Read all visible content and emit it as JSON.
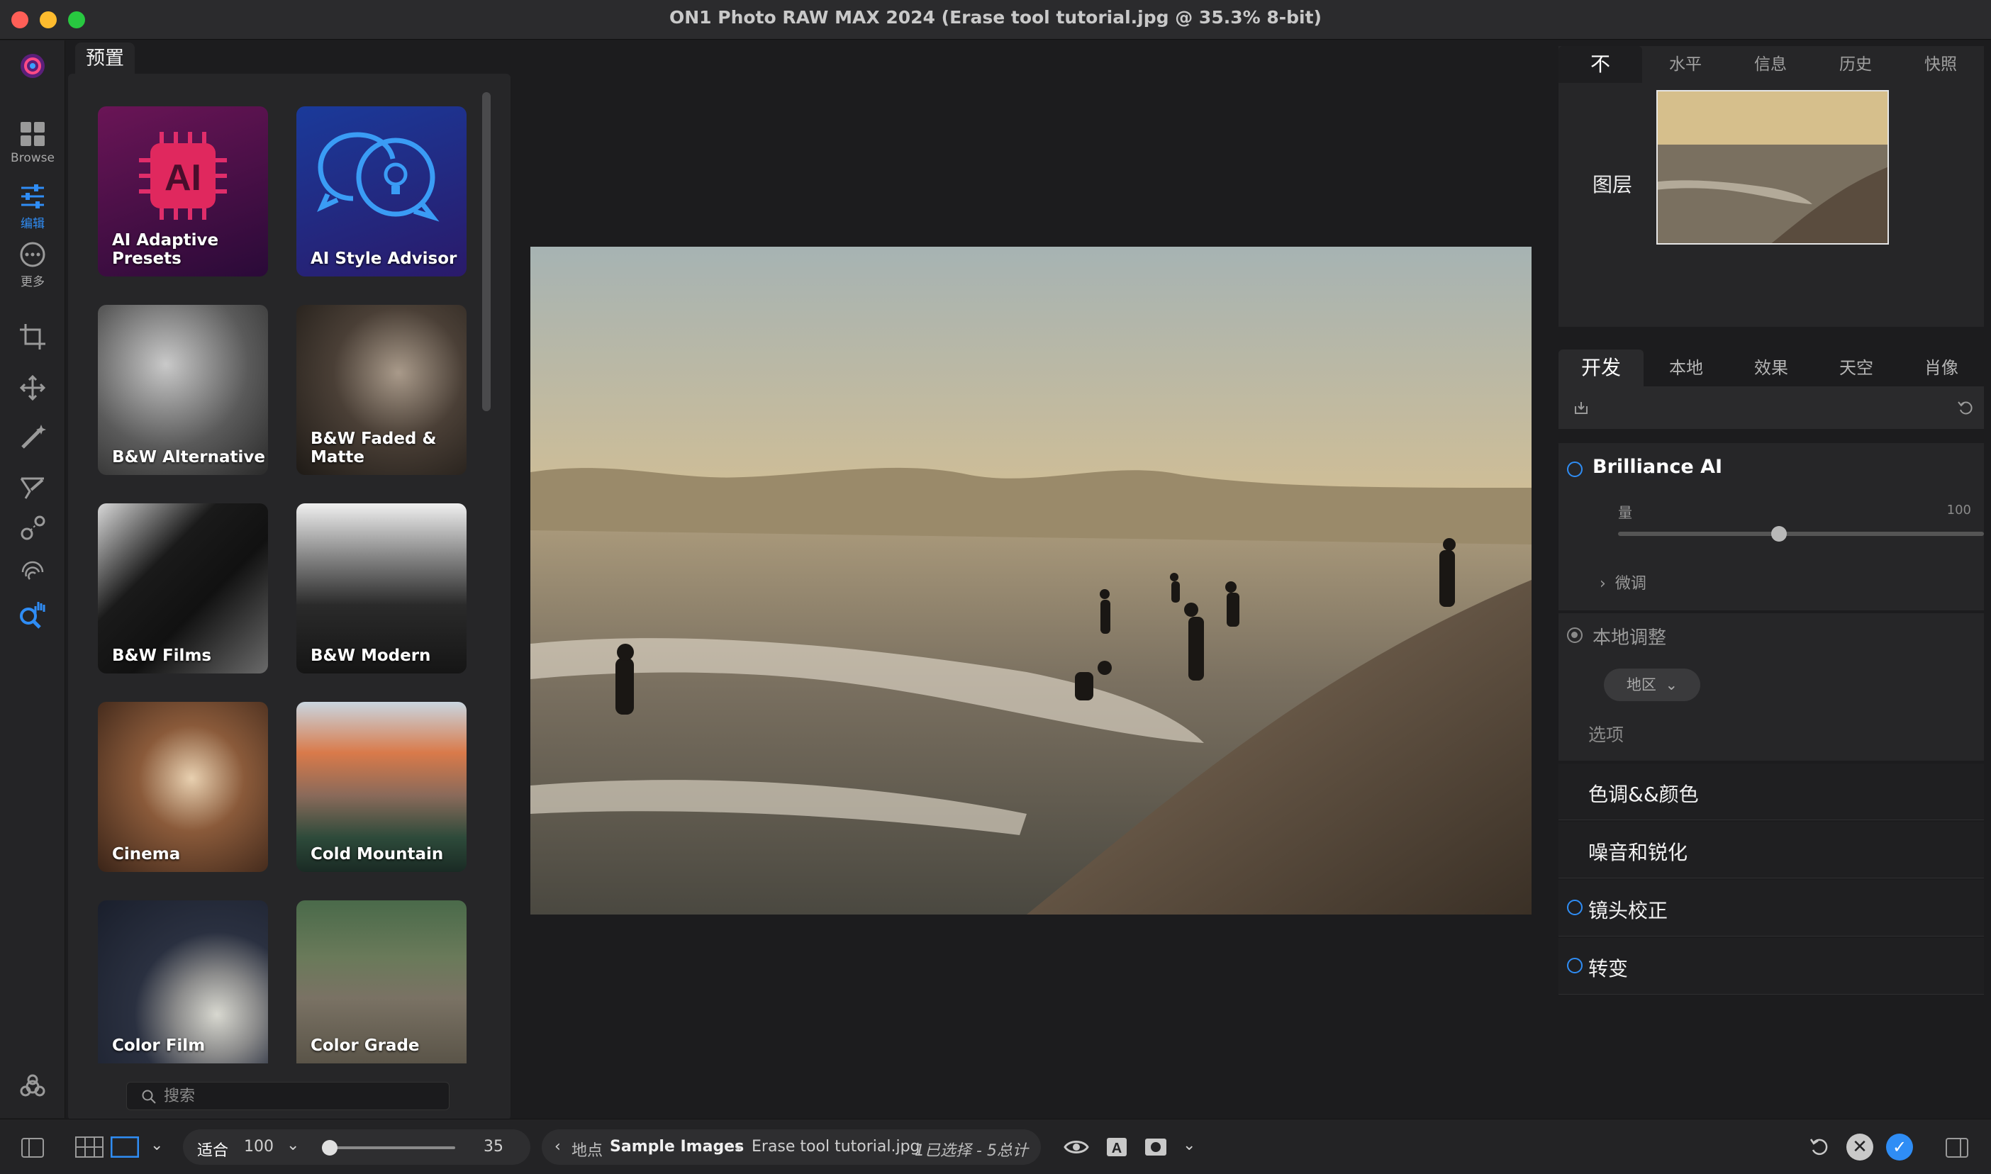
{
  "window": {
    "title": "ON1 Photo RAW MAX 2024 (Erase tool tutorial.jpg @ 35.3% 8-bit)"
  },
  "left_toolbar": {
    "browse_label": "Browse",
    "edit_label": "编辑",
    "more_label": "更多"
  },
  "presets": {
    "tab_label": "预置",
    "search_placeholder": "搜索",
    "items": [
      {
        "label": "AI Adaptive Presets"
      },
      {
        "label": "AI Style Advisor"
      },
      {
        "label": "B&W Alternative"
      },
      {
        "label": "B&W Faded & Matte"
      },
      {
        "label": "B&W Films"
      },
      {
        "label": "B&W Modern"
      },
      {
        "label": "Cinema"
      },
      {
        "label": "Cold Mountain"
      },
      {
        "label": "Color Film"
      },
      {
        "label": "Color Grade"
      }
    ]
  },
  "right_panel": {
    "top_tabs": [
      "不",
      "水平",
      "信息",
      "历史",
      "快照"
    ],
    "layers_title": "图层",
    "sub_tabs": [
      "开发",
      "本地",
      "效果",
      "天空",
      "肖像"
    ],
    "brilliance": {
      "title": "Brilliance AI",
      "amount_label": "量",
      "amount_value": "100",
      "amount_fraction": 0.44,
      "fine_tune_label": "微调"
    },
    "local_adjust": {
      "title": "本地调整",
      "region_label": "地区",
      "options_label": "选项"
    },
    "sections": [
      {
        "label": "色调&&颜色",
        "has_radio": false
      },
      {
        "label": "噪音和锐化",
        "has_radio": false
      },
      {
        "label": "镜头校正",
        "has_radio": true
      },
      {
        "label": "转变",
        "has_radio": true
      }
    ]
  },
  "bottom_bar": {
    "fit_label": "适合",
    "zoom_value": "100",
    "size_value": "35",
    "size_fraction": 0.0,
    "location_label": "地点",
    "folder": "Sample Images",
    "filename": "Erase tool tutorial.jpg",
    "selection_info": "1已选择 - 5总计"
  },
  "colors": {
    "accent": "#2f8df5",
    "panel": "#262628",
    "background": "#1c1c1e"
  }
}
